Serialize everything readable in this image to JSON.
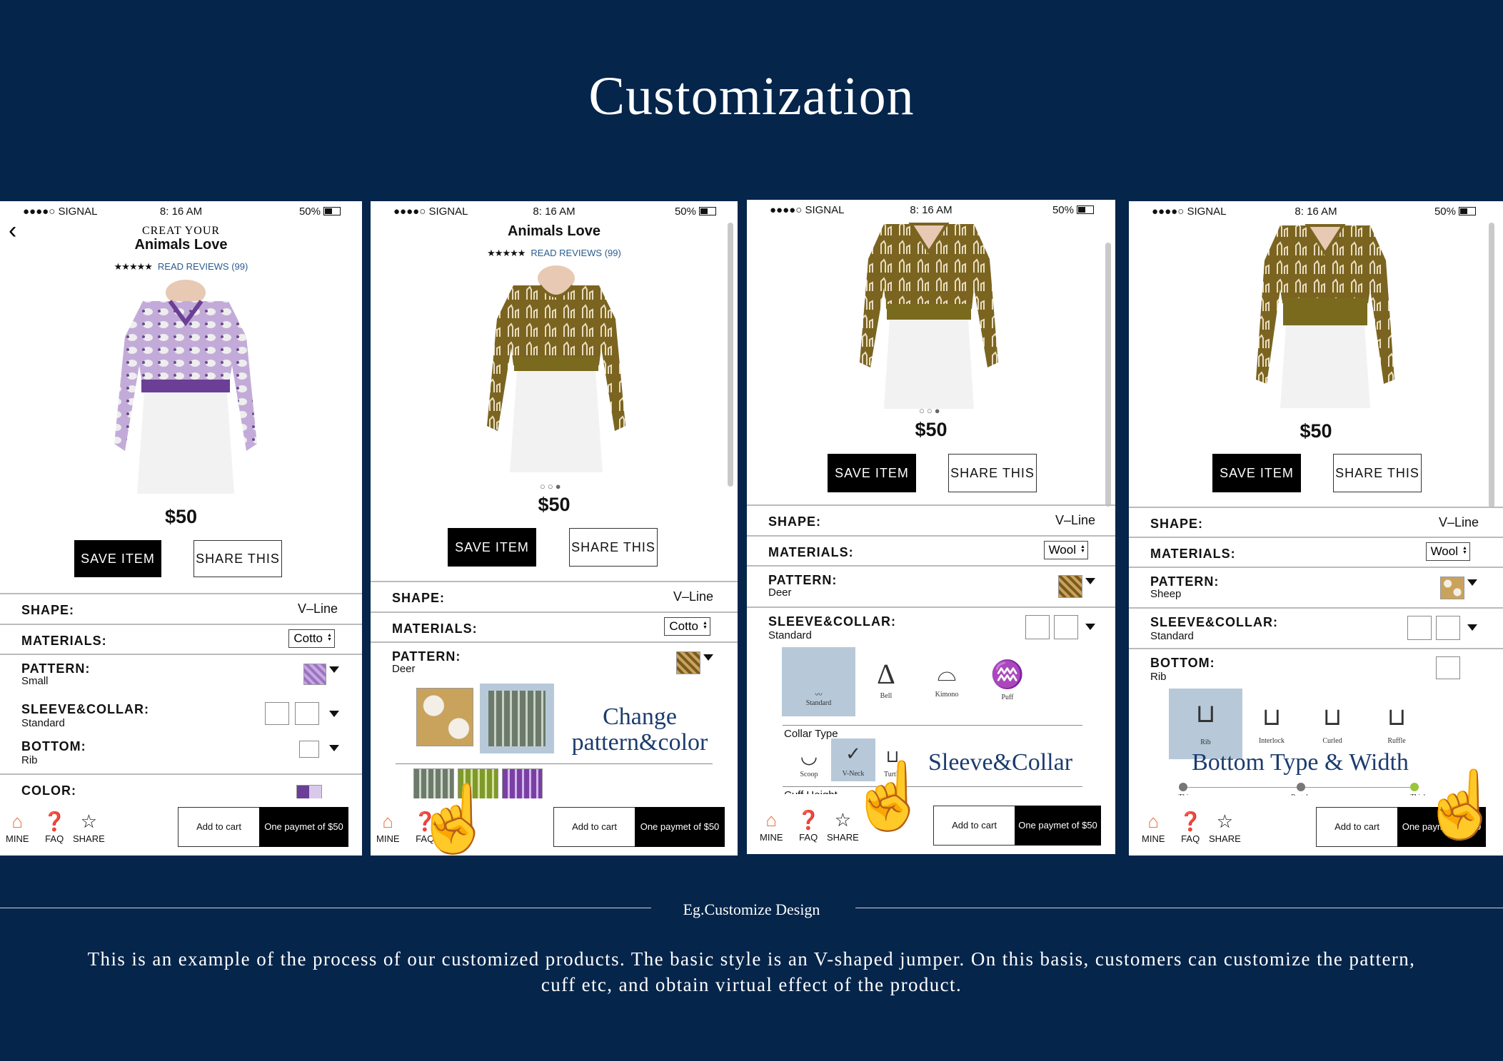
{
  "title": "Customization",
  "status": {
    "signal": "●●●●○ SIGNAL",
    "time": "8: 16 AM",
    "battery": "50%"
  },
  "product": {
    "brand_line": "CREAT YOUR",
    "name": "Animals Love",
    "stars": "★★★★★",
    "reviews": "READ REVIEWS (99)",
    "price": "$50"
  },
  "buttons": {
    "save": "SAVE  ITEM",
    "share": "SHARE  THIS"
  },
  "labels": {
    "shape": "SHAPE:",
    "materials": "MATERIALS:",
    "pattern": "PATTERN:",
    "sleeve": "SLEEVE&COLLAR:",
    "bottom": "BOTTOM:",
    "color": "COLOR:"
  },
  "values": {
    "shape": "V–Line",
    "standard": "Standard",
    "rib": "Rib"
  },
  "screens": [
    {
      "material": "Cotto",
      "pattern": "Small"
    },
    {
      "material": "Cotto",
      "pattern": "Deer",
      "overlay": "Change\npattern&color"
    },
    {
      "material": "Wool",
      "pattern": "Deer",
      "overlay": "Sleeve&Collar",
      "sleeve_opts": [
        "Standard",
        "Bell",
        "Kimono",
        "Puff"
      ],
      "collar_type": "Collar Type",
      "collar_opts": [
        "Scoop",
        "V-Neck",
        "Turtle"
      ],
      "cuff": "Cuff Height"
    },
    {
      "material": "Wool",
      "pattern": "Sheep",
      "overlay": "Bottom Type & Width",
      "bottom_opts": [
        "Rib",
        "Interlock",
        "Curled",
        "Ruffle"
      ],
      "width_opts": [
        "Thin",
        "Regular",
        "Thick"
      ]
    }
  ],
  "nav": {
    "mine": "MINE",
    "faq": "FAQ",
    "share": "SHARE"
  },
  "cta": {
    "cart": "Add to cart",
    "pay": "One paymet  of $50"
  },
  "caption": "Eg.Customize Design",
  "description": "This is an example of the process of our customized products. The basic style is an V-shaped jumper. On this basis, customers can customize the pattern, cuff etc, and obtain virtual effect of the product.",
  "colors": {
    "background": "#05254b",
    "purple": "#9b7cc0",
    "olive": "#7a6a1e",
    "highlight": "#b7c9d8",
    "overlay_text": "#1c3c6e"
  },
  "icons": [
    "back-chevron-icon",
    "wifi-icon",
    "battery-icon",
    "store-icon",
    "question-icon",
    "star-icon",
    "pointer-hand-icon",
    "dropdown-caret-icon"
  ]
}
